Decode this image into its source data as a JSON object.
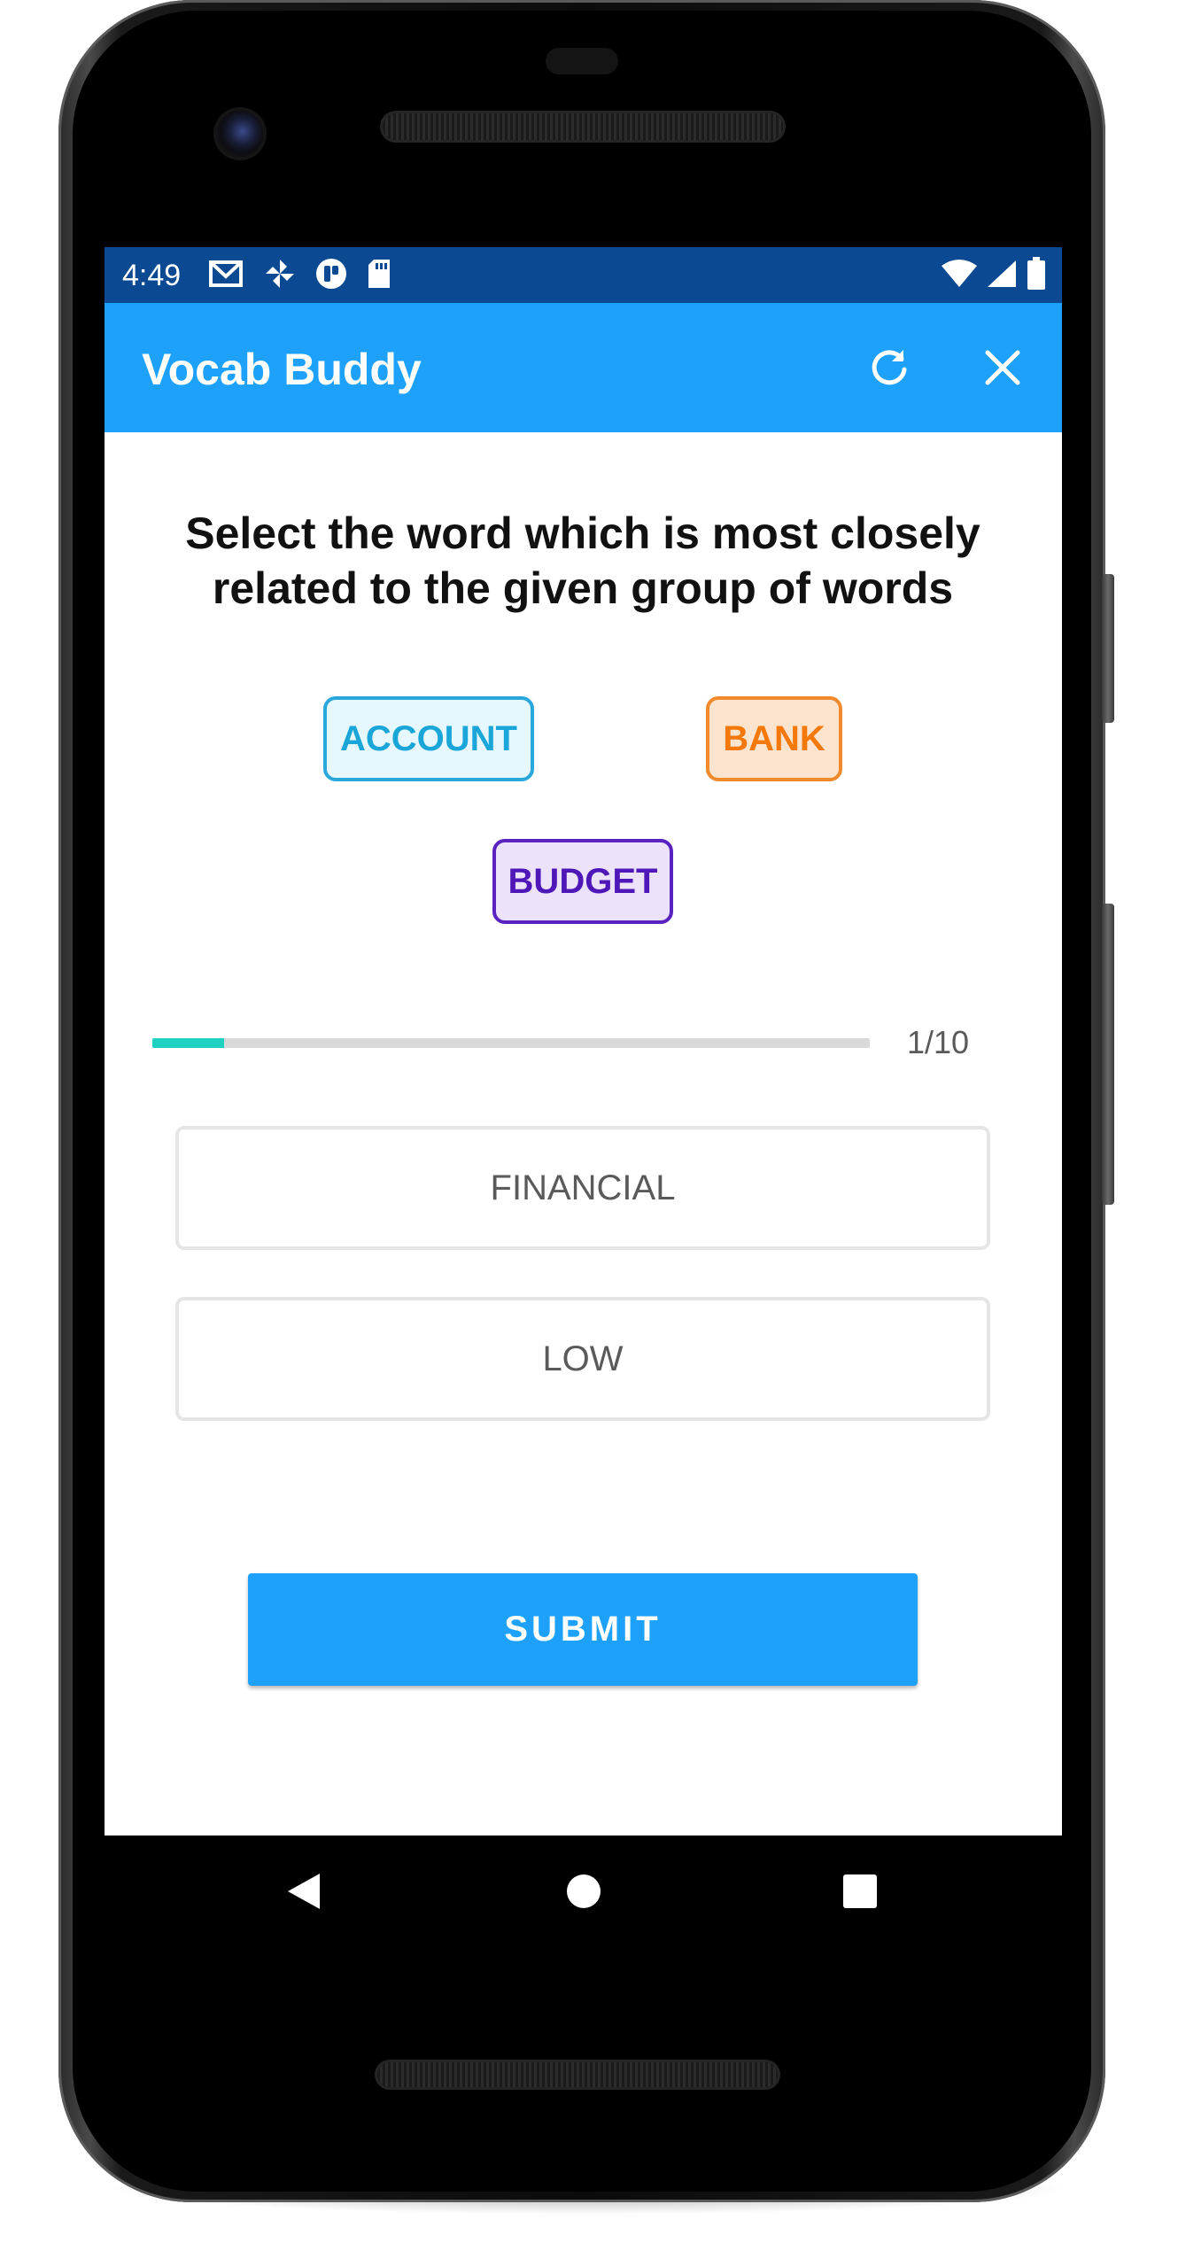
{
  "status_bar": {
    "time": "4:49",
    "left_icons": [
      "gmail-icon",
      "pinwheel-icon",
      "app-badge-icon",
      "sd-card-icon"
    ],
    "right_icons": [
      "wifi-icon",
      "signal-icon",
      "battery-icon"
    ]
  },
  "app_bar": {
    "title": "Vocab Buddy",
    "actions": [
      "refresh-icon",
      "close-icon"
    ]
  },
  "question": {
    "text": "Select the word which is most closely related to the given group of words"
  },
  "given_words": [
    {
      "label": "ACCOUNT",
      "text_color": "#1aa6d8",
      "border_color": "#2aa8dc",
      "bg_color": "#e6f8fd"
    },
    {
      "label": "BANK",
      "text_color": "#f5780a",
      "border_color": "#f08a2c",
      "bg_color": "#fde4cf"
    },
    {
      "label": "BUDGET",
      "text_color": "#4f16b8",
      "border_color": "#5a22bf",
      "bg_color": "#ece3fb"
    }
  ],
  "progress": {
    "label": "1/10",
    "fraction": 0.1,
    "color": "#1fd1c1"
  },
  "options": [
    {
      "label": "FINANCIAL"
    },
    {
      "label": "LOW"
    }
  ],
  "submit": {
    "label": "SUBMIT",
    "color": "#1da1fb"
  },
  "nav_bar": {
    "buttons": [
      "back-icon",
      "home-icon",
      "recents-icon"
    ]
  }
}
